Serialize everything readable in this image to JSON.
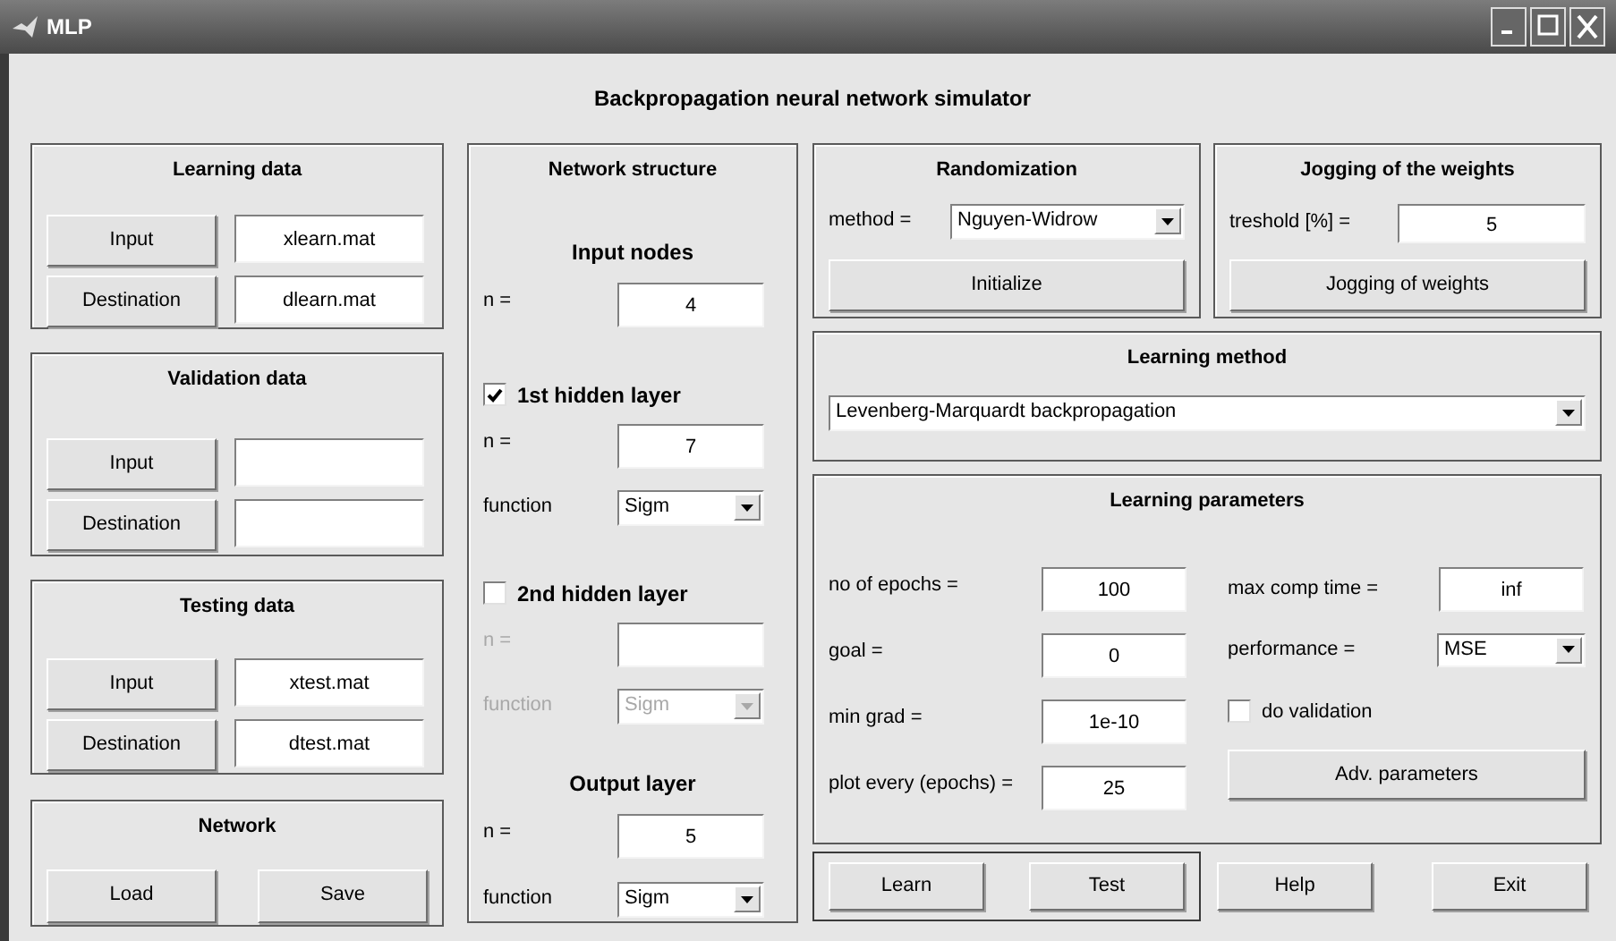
{
  "window": {
    "title": "MLP"
  },
  "heading": "Backpropagation neural network simulator",
  "data_panels": [
    {
      "title": "Learning data",
      "rows": [
        {
          "button": "Input",
          "value": "xlearn.mat"
        },
        {
          "button": "Destination",
          "value": "dlearn.mat"
        }
      ]
    },
    {
      "title": "Validation data",
      "rows": [
        {
          "button": "Input"
        },
        {
          "button": "Destination"
        }
      ]
    },
    {
      "title": "Testing data",
      "rows": [
        {
          "button": "Input",
          "value": "xtest.mat"
        },
        {
          "button": "Destination",
          "value": "dtest.mat"
        }
      ]
    }
  ],
  "network": {
    "title": "Network",
    "buttons": [
      "Load",
      "Save"
    ]
  },
  "network_structure": {
    "title": "Network structure",
    "input_nodes": {
      "title": "Input nodes",
      "n_label": "n =",
      "n": "4"
    },
    "hidden_layers": [
      {
        "label": "1st hidden layer",
        "checked": true,
        "n_label": "n =",
        "n": "7",
        "function_label": "function",
        "function": "Sigm"
      },
      {
        "label": "2nd hidden layer",
        "checked": false,
        "n_label": "n =",
        "function_label": "function",
        "function": "Sigm"
      }
    ],
    "output_layer": {
      "title": "Output layer",
      "n_label": "n =",
      "n": "5",
      "function_label": "function",
      "function": "Sigm"
    }
  },
  "randomization": {
    "title": "Randomization",
    "method_label": "method =",
    "method": "Nguyen-Widrow",
    "button": "Initialize"
  },
  "jogging": {
    "title": "Jogging of the weights",
    "threshold_label": "treshold [%] =",
    "threshold": "5",
    "button": "Jogging of weights"
  },
  "learning_method": {
    "title": "Learning method",
    "method": "Levenberg-Marquardt backpropagation"
  },
  "learning_parameters": {
    "title": "Learning parameters",
    "left": [
      {
        "label": "no of epochs =",
        "value": "100"
      },
      {
        "label": "goal =",
        "value": "0"
      },
      {
        "label": "min grad =",
        "value": "1e-10"
      },
      {
        "label": "plot every (epochs) =",
        "value": "25"
      }
    ],
    "right": [
      {
        "kind": "field",
        "label": "max comp time =",
        "value": "inf"
      },
      {
        "kind": "dropdown",
        "label": "performance =",
        "value": "MSE"
      },
      {
        "kind": "checkbox",
        "label": "do validation",
        "checked": false
      },
      {
        "kind": "button",
        "label": "Adv. parameters"
      }
    ]
  },
  "run_buttons": [
    "Learn",
    "Test"
  ],
  "buttons": [
    "Help",
    "Exit"
  ]
}
